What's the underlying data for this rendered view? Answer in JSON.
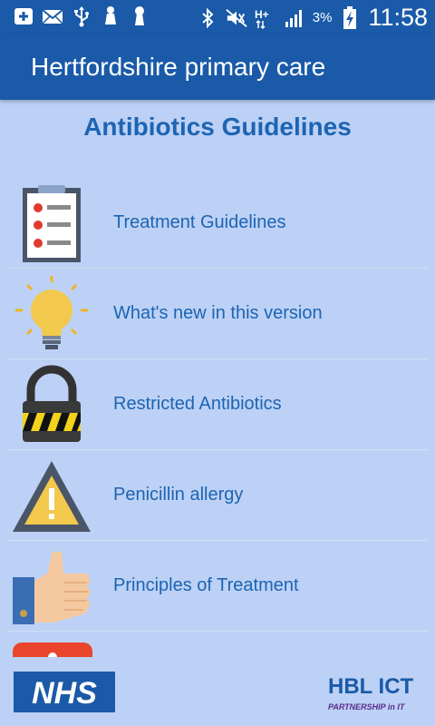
{
  "statusbar": {
    "battery_pct": "3%",
    "clock": "11:58",
    "icons_left": [
      "add-icon",
      "email-icon",
      "usb-icon",
      "bell-icon",
      "keyhole-icon"
    ],
    "icons_right": [
      "bluetooth-icon",
      "mute-icon",
      "hplus-icon",
      "signal-icon",
      "battery-charging-icon"
    ]
  },
  "appbar": {
    "title": "Hertfordshire primary care"
  },
  "page": {
    "title": "Antibiotics Guidelines"
  },
  "menu": {
    "items": [
      {
        "label": "Treatment Guidelines",
        "icon": "clipboard-icon"
      },
      {
        "label": "What's new in this version",
        "icon": "lightbulb-icon"
      },
      {
        "label": "Restricted Antibiotics",
        "icon": "padlock-icon"
      },
      {
        "label": "Penicillin allergy",
        "icon": "warning-icon"
      },
      {
        "label": "Principles of Treatment",
        "icon": "thumbs-up-icon"
      },
      {
        "label": "",
        "icon": "red-icon"
      }
    ]
  },
  "footer": {
    "nhs_logo": "NHS",
    "hbl_logo": "HBL ICT",
    "hbl_tagline": "PARTNERSHIP in IT"
  },
  "colors": {
    "bar": "#1a5aa8",
    "background": "#bcd1f5",
    "accent_text": "#1d64b3"
  }
}
